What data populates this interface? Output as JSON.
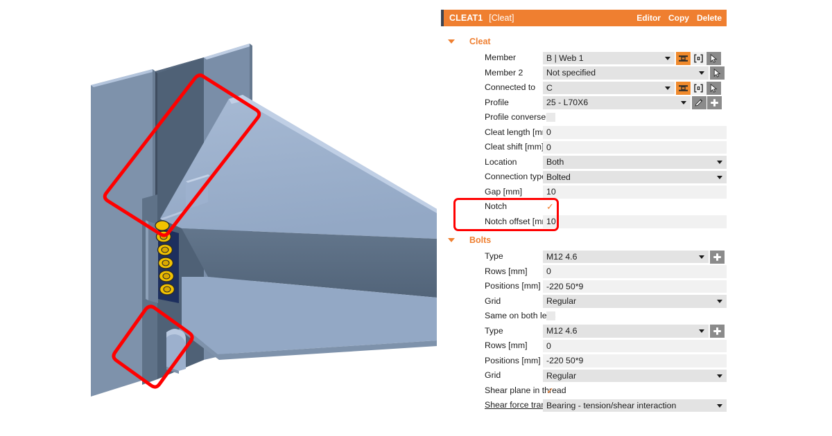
{
  "header": {
    "title": "CLEAT1",
    "subtitle": "[Cleat]",
    "actions": [
      "Editor",
      "Copy",
      "Delete"
    ],
    "accent_color": "#ef7f30",
    "accent_bar_color": "#3c4452"
  },
  "sections": [
    {
      "id": "cleat",
      "label": "Cleat",
      "rows": [
        {
          "label": "Member",
          "value": "B | Web 1",
          "kind": "dropdown",
          "field_w": 190,
          "buttons": [
            "profile-orange-icon",
            "extent-icon",
            "pointer-icon"
          ]
        },
        {
          "label": "Member 2",
          "value": "Not specified",
          "kind": "dropdown",
          "field_w": 239,
          "buttons": [
            "pointer-icon"
          ]
        },
        {
          "label": "Connected to",
          "value": "C",
          "kind": "dropdown",
          "field_w": 190,
          "buttons": [
            "profile-orange-icon",
            "extent-icon",
            "pointer-icon"
          ]
        },
        {
          "label": "Profile",
          "value": "25 - L70X6",
          "kind": "dropdown",
          "field_w": 213,
          "buttons": [
            "pencil-icon",
            "plus-icon"
          ]
        },
        {
          "label": "Profile conversely",
          "value": "",
          "kind": "checkbox-empty"
        },
        {
          "label": "Cleat length [mm]",
          "value": "0",
          "kind": "plain",
          "field_w": 265
        },
        {
          "label": "Cleat shift [mm]",
          "value": "0",
          "kind": "plain",
          "field_w": 265
        },
        {
          "label": "Location",
          "value": "Both",
          "kind": "dropdown",
          "field_w": 265
        },
        {
          "label": "Connection type",
          "value": "Bolted",
          "kind": "dropdown",
          "field_w": 265
        },
        {
          "label": "Gap [mm]",
          "value": "10",
          "kind": "plain",
          "field_w": 265
        },
        {
          "label": "Notch",
          "value": "",
          "kind": "checkbox-checked"
        },
        {
          "label": "Notch offset [mm]",
          "value": "10",
          "kind": "plain",
          "field_w": 265
        }
      ]
    },
    {
      "id": "bolts",
      "label": "Bolts",
      "rows": [
        {
          "label": "Type",
          "value": "M12 4.6",
          "kind": "dropdown",
          "field_w": 239,
          "buttons": [
            "plus-icon"
          ]
        },
        {
          "label": "Rows [mm]",
          "value": "0",
          "kind": "plain",
          "field_w": 265
        },
        {
          "label": "Positions [mm]",
          "value": "-220 50*9",
          "kind": "plain",
          "field_w": 265
        },
        {
          "label": "Grid",
          "value": "Regular",
          "kind": "dropdown",
          "field_w": 265
        },
        {
          "label": "Same on both legs",
          "value": "",
          "kind": "checkbox-empty"
        },
        {
          "label": "Type",
          "value": "M12 4.6",
          "kind": "dropdown",
          "field_w": 239,
          "buttons": [
            "plus-icon"
          ]
        },
        {
          "label": "Rows [mm]",
          "value": "0",
          "kind": "plain",
          "field_w": 265
        },
        {
          "label": "Positions [mm]",
          "value": "-220 50*9",
          "kind": "plain",
          "field_w": 265
        },
        {
          "label": "Grid",
          "value": "Regular",
          "kind": "dropdown",
          "field_w": 265
        },
        {
          "label": "Shear plane in thread",
          "value": "",
          "kind": "checkbox-checked"
        },
        {
          "label": "Shear force transfer",
          "value": "Bearing - tension/shear interaction",
          "kind": "dropdown",
          "field_w": 265,
          "underline": true
        }
      ]
    }
  ],
  "annotations": {
    "highlight_color": "#ff0000",
    "notch_highlight_label": "notch-rows-highlight",
    "model_highlight_top_label": "notch-top-highlight",
    "model_highlight_bottom_label": "notch-bottom-highlight"
  },
  "viewport": {
    "background": "#ffffff",
    "steel_light": "#9cb0cd",
    "steel_mid": "#8fa4c2",
    "steel_dark": "#5d7086",
    "steel_shadow": "#47586c",
    "web_dark": "#3c4a5c",
    "plate_navy": "#1d2f5e",
    "bolt_gold": "#f2c200",
    "bolt_gold_dark": "#c79b00",
    "bolt_count": 6,
    "checkmark_glyph": "✓"
  }
}
